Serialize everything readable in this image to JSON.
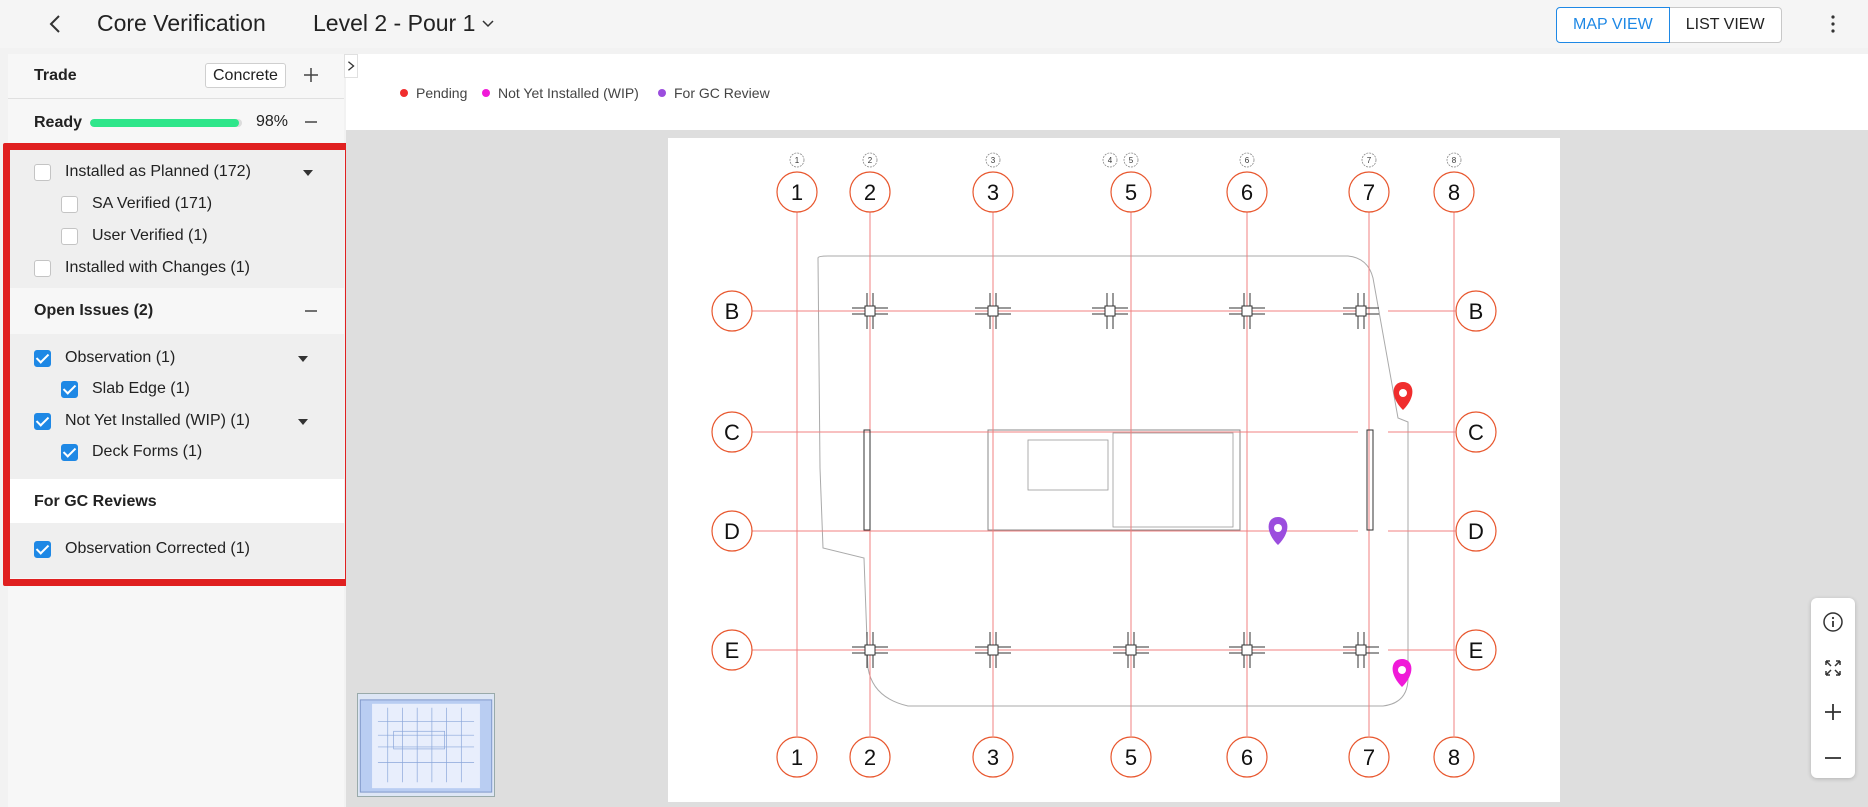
{
  "header": {
    "title": "Core Verification",
    "level": "Level 2 - Pour 1",
    "map_view": "MAP VIEW",
    "list_view": "LIST VIEW"
  },
  "sidebar": {
    "trade_label": "Trade",
    "trade_value": "Concrete",
    "ready_label": "Ready",
    "ready_pct": "98%",
    "ready_fraction": 0.98,
    "installed": [
      {
        "label": "Installed as Planned (172)",
        "checked": false
      },
      {
        "label": "SA Verified (171)",
        "checked": false
      },
      {
        "label": "User Verified (1)",
        "checked": false
      },
      {
        "label": "Installed with Changes (1)",
        "checked": false
      }
    ],
    "open_issues_label": "Open Issues (2)",
    "open_issues": [
      {
        "label": "Observation (1)",
        "checked": true
      },
      {
        "label": "Slab Edge (1)",
        "checked": true
      },
      {
        "label": "Not Yet Installed (WIP) (1)",
        "checked": true
      },
      {
        "label": "Deck Forms (1)",
        "checked": true
      }
    ],
    "gc_label": "For GC Reviews",
    "gc_items": [
      {
        "label": "Observation Corrected (1)",
        "checked": true
      }
    ]
  },
  "legend": [
    {
      "label": "Pending",
      "color": "#f02d2d"
    },
    {
      "label": "Not Yet Installed (WIP)",
      "color": "#f01ad8"
    },
    {
      "label": "For GC Review",
      "color": "#9b4dde"
    }
  ],
  "plan": {
    "grid_columns": [
      "1",
      "2",
      "3",
      "5",
      "6",
      "7",
      "8"
    ],
    "grid_columns_small": [
      "1",
      "2",
      "3",
      "4",
      "5",
      "6",
      "7",
      "8"
    ],
    "grid_rows": [
      "B",
      "C",
      "D",
      "E"
    ]
  },
  "colors": {
    "accent": "#1e88e5",
    "grid_line": "#f08080",
    "bubble": "#e8572e",
    "highlight": "#e02020"
  }
}
